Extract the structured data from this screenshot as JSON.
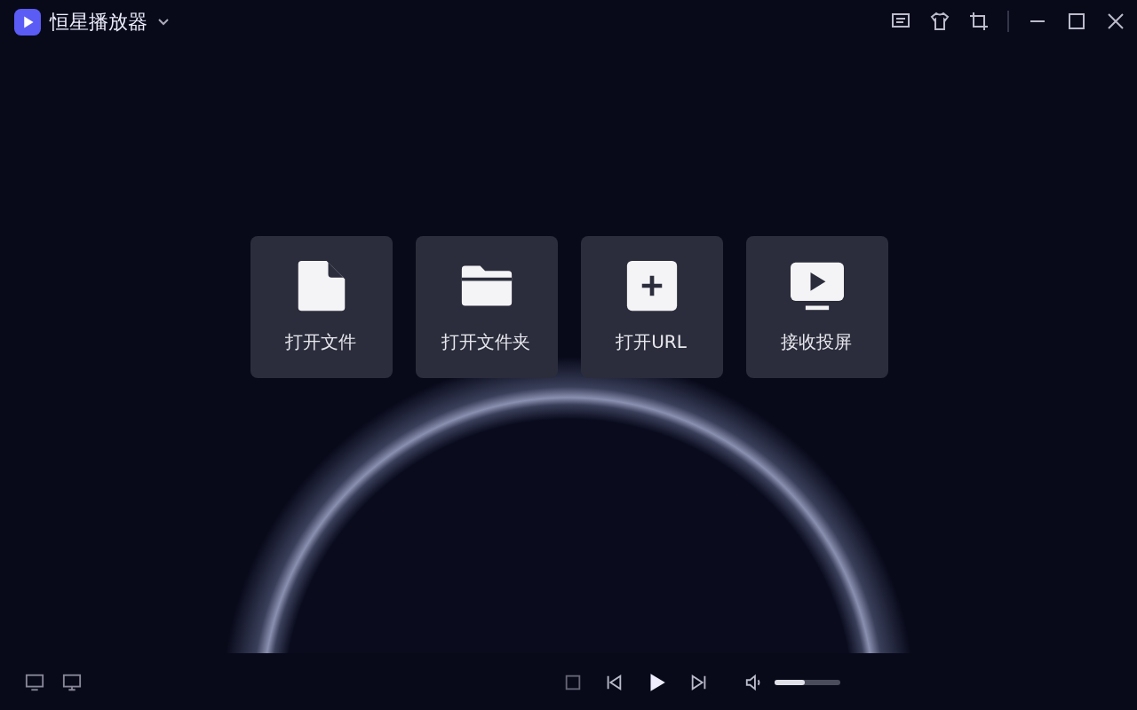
{
  "window": {
    "title": "恒星播放器"
  },
  "actions": [
    {
      "label": "打开文件",
      "kind": "file"
    },
    {
      "label": "打开文件夹",
      "kind": "folder"
    },
    {
      "label": "打开URL",
      "kind": "url"
    },
    {
      "label": "接收投屏",
      "kind": "cast"
    }
  ],
  "player": {
    "volume": {
      "level": 0.45
    }
  }
}
